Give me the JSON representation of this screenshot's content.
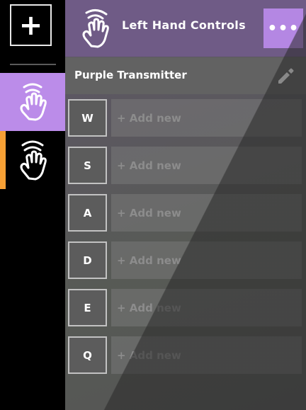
{
  "rail": {
    "add_label": "+",
    "items": [
      {
        "icon": "hand-wave-icon",
        "active": true
      },
      {
        "icon": "hand-wave-icon",
        "active": false
      }
    ]
  },
  "header": {
    "title": "Left Hand Controls",
    "more_label": "•••"
  },
  "subheader": {
    "title": "Purple Transmitter"
  },
  "keys": [
    {
      "key": "W",
      "placeholder": "+ Add new"
    },
    {
      "key": "S",
      "placeholder": "+ Add new"
    },
    {
      "key": "A",
      "placeholder": "+ Add new"
    },
    {
      "key": "D",
      "placeholder": "+ Add new"
    },
    {
      "key": "E",
      "placeholder": "+ Add new"
    },
    {
      "key": "Q",
      "placeholder": "+ Add new"
    }
  ],
  "colors": {
    "accent_purple": "#bb8ce9",
    "header_purple": "#6f5b86",
    "accent_orange": "#f7a035"
  }
}
